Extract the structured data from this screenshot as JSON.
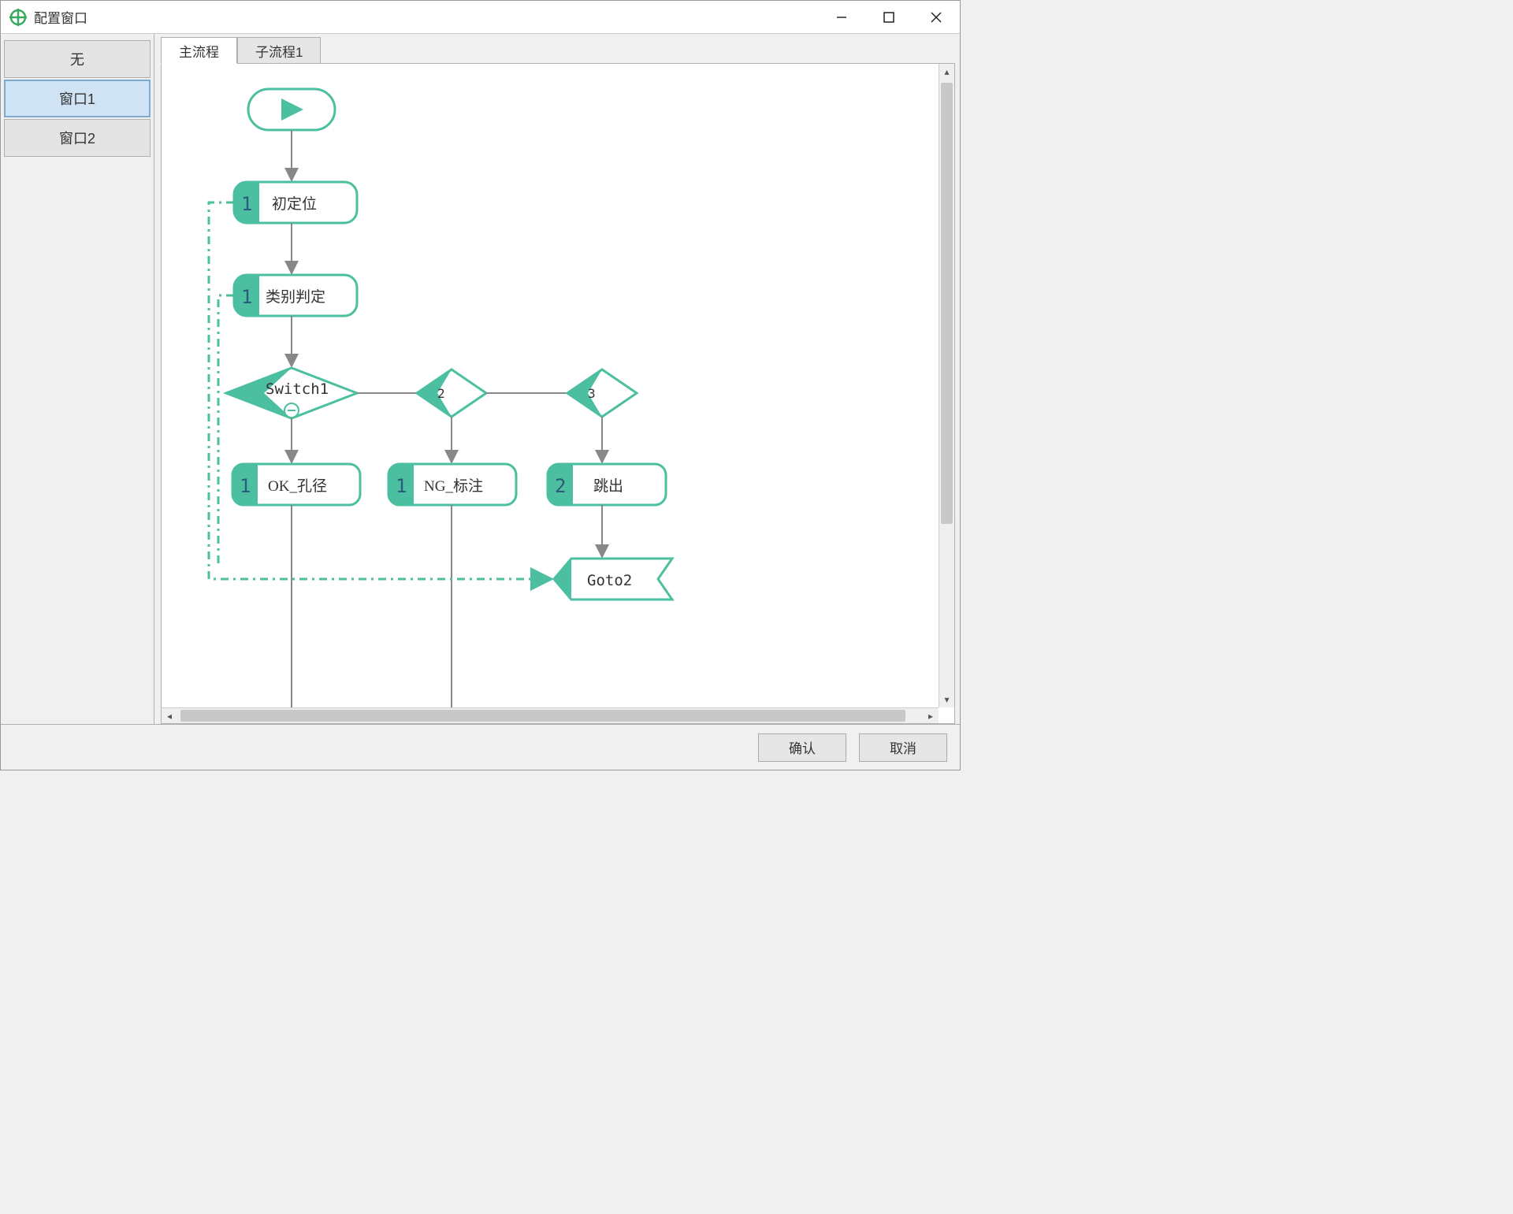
{
  "window": {
    "title": "配置窗口"
  },
  "sidebar": {
    "items": [
      {
        "label": "无",
        "selected": false
      },
      {
        "label": "窗口1",
        "selected": true
      },
      {
        "label": "窗口2",
        "selected": false
      }
    ]
  },
  "tabs": [
    {
      "label": "主流程",
      "active": true
    },
    {
      "label": "子流程1",
      "active": false
    }
  ],
  "flow": {
    "start": "▶",
    "nodes": {
      "n1": {
        "num": "1",
        "label": "初定位"
      },
      "n2": {
        "num": "1",
        "label": "类别判定"
      },
      "switch": {
        "label": "Switch1",
        "branches": [
          "2",
          "3"
        ]
      },
      "b1": {
        "num": "1",
        "label": "OK_孔径"
      },
      "b2": {
        "num": "1",
        "label": "NG_标注"
      },
      "b3": {
        "num": "2",
        "label": "跳出"
      },
      "goto": {
        "label": "Goto2"
      }
    }
  },
  "footer": {
    "ok": "确认",
    "cancel": "取消"
  },
  "colors": {
    "accent": "#4bbfa0",
    "accent_dark": "#3aa388",
    "node_border": "#4bbfa0"
  }
}
